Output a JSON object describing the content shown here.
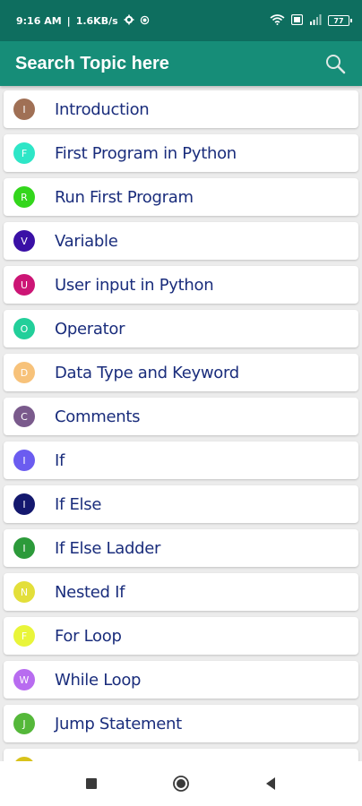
{
  "status_bar": {
    "time": "9:16 AM",
    "speed": "1.6KB/s",
    "separator": "|",
    "battery": "77"
  },
  "app_bar": {
    "title": "Search Topic here",
    "search_icon": "search-icon"
  },
  "topics": [
    {
      "letter": "I",
      "label": "Introduction",
      "color": "#a07055"
    },
    {
      "letter": "F",
      "label": "First Program in Python",
      "color": "#2ee6c7"
    },
    {
      "letter": "R",
      "label": "Run First Program",
      "color": "#33d61c"
    },
    {
      "letter": "V",
      "label": "Variable",
      "color": "#3a10a6"
    },
    {
      "letter": "U",
      "label": "User input in Python",
      "color": "#cc1575"
    },
    {
      "letter": "O",
      "label": "Operator",
      "color": "#22cf9a"
    },
    {
      "letter": "D",
      "label": "Data Type and Keyword",
      "color": "#f7c27a"
    },
    {
      "letter": "C",
      "label": "Comments",
      "color": "#7a5a8c"
    },
    {
      "letter": "I",
      "label": "If",
      "color": "#6b5cf0"
    },
    {
      "letter": "I",
      "label": "If Else",
      "color": "#14186e"
    },
    {
      "letter": "I",
      "label": "If Else Ladder",
      "color": "#2c9a3a"
    },
    {
      "letter": "N",
      "label": "Nested If",
      "color": "#e3df3a"
    },
    {
      "letter": "F",
      "label": "For Loop",
      "color": "#e9f53a"
    },
    {
      "letter": "W",
      "label": "While Loop",
      "color": "#b86cf0"
    },
    {
      "letter": "J",
      "label": "Jump Statement",
      "color": "#55b83a"
    },
    {
      "letter": "",
      "label": "",
      "color": "#d8c21a"
    }
  ],
  "nav_bar": {
    "buttons": [
      "recent-apps-icon",
      "home-icon",
      "back-icon"
    ]
  }
}
